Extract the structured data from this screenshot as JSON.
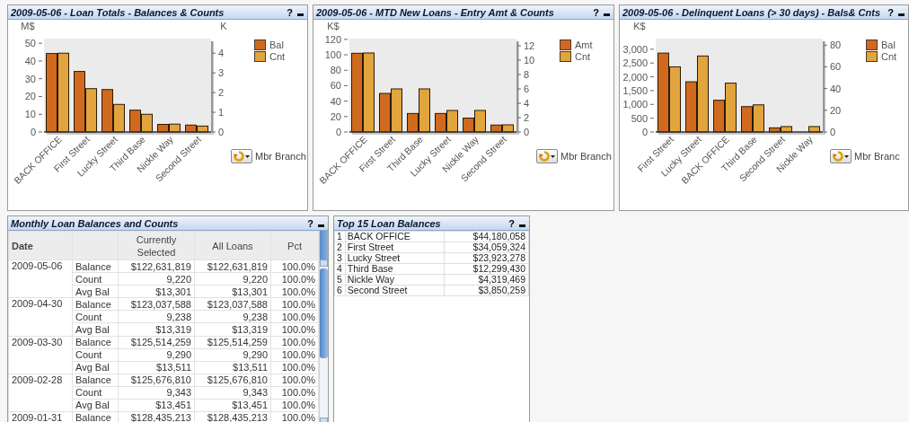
{
  "charts": [
    {
      "title": "2009-05-06 - Loan Totals - Balances & Counts",
      "help": "?",
      "cycle_label": "Mbr Branch",
      "chart_data": {
        "type": "bar",
        "ylabel": "M$",
        "y2label": "K",
        "categories": [
          "BACK OFFICE",
          "First Street",
          "Lucky Street",
          "Third Base",
          "Nickle Way",
          "Second Street"
        ],
        "ylim": [
          0,
          52.6
        ],
        "yticks": [
          0,
          10,
          20,
          30,
          40,
          50
        ],
        "y2lim": [
          0,
          4.74
        ],
        "y2ticks": [
          0,
          1,
          2,
          3,
          4
        ],
        "series": [
          {
            "name": "Bal",
            "color": "#d06a1e",
            "values": [
              44.2,
              34.1,
              23.9,
              12.3,
              4.3,
              3.9
            ]
          },
          {
            "name": "Cnt",
            "color": "#e2a43c",
            "axis": "y2",
            "values": [
              4.0,
              2.2,
              1.4,
              0.9,
              0.4,
              0.3
            ]
          }
        ],
        "stacked": false
      }
    },
    {
      "title": "2009-05-06 - MTD New Loans - Entry Amt & Counts",
      "help": "?",
      "cycle_label": "Mbr Branch",
      "chart_data": {
        "type": "bar",
        "ylabel": "K$",
        "categories": [
          "BACK OFFICE",
          "First Street",
          "Third Base",
          "Lucky Street",
          "Nickle Way",
          "Second Street"
        ],
        "ylim": [
          0,
          121
        ],
        "yticks": [
          0,
          20,
          40,
          60,
          80,
          100,
          120
        ],
        "y2lim": [
          0,
          13
        ],
        "y2ticks": [
          0,
          2,
          4,
          6,
          8,
          10,
          12
        ],
        "series": [
          {
            "name": "Amt",
            "color": "#d06a1e",
            "values": [
              102,
              50,
              24,
              24,
              18,
              9
            ]
          },
          {
            "name": "Cnt",
            "color": "#e2a43c",
            "axis": "y2",
            "values": [
              11,
              6,
              6,
              3,
              3,
              1
            ]
          }
        ],
        "stacked": false
      }
    },
    {
      "title": "2009-05-06 - Delinquent Loans (> 30 days) - Bals& Cnts",
      "help": "?",
      "cycle_label": "Mbr Branc",
      "chart_data": {
        "type": "bar",
        "ylabel": "K$",
        "categories": [
          "First Street",
          "Lucky Street",
          "BACK OFFICE",
          "Third Base",
          "Second Street",
          "Nickle Way"
        ],
        "ylim": [
          0,
          3385
        ],
        "yticks": [
          {
            "value": 0,
            "label": "0"
          },
          {
            "value": 500,
            "label": "500"
          },
          {
            "value": 1000,
            "label": "1,000"
          },
          {
            "value": 1500,
            "label": "1,500"
          },
          {
            "value": 2000,
            "label": "2,000"
          },
          {
            "value": 2500,
            "label": "2,500"
          },
          {
            "value": 3000,
            "label": "3,000"
          }
        ],
        "y2lim": [
          0,
          86
        ],
        "y2ticks": [
          0,
          20,
          40,
          60,
          80
        ],
        "series": [
          {
            "name": "Bal",
            "color": "#d06a1e",
            "values": [
              2860,
              1820,
              1150,
              920,
              150,
              null
            ]
          },
          {
            "name": "Cnt",
            "color": "#e2a43c",
            "axis": "y2",
            "values": [
              60,
              70,
              45,
              25,
              5,
              5
            ]
          }
        ],
        "stacked": false
      }
    }
  ],
  "monthly": {
    "title": "Monthly Loan Balances and Counts",
    "help": "?",
    "columns": [
      "Date",
      "Currently Selected",
      "All Loans",
      "Pct"
    ],
    "groups": [
      {
        "date": "2009-05-06",
        "rows": [
          {
            "measure": "Balance",
            "current": "$122,631,819",
            "all": "$122,631,819",
            "pct": "100.0%"
          },
          {
            "measure": "Count",
            "current": "9,220",
            "all": "9,220",
            "pct": "100.0%"
          },
          {
            "measure": "Avg Bal",
            "current": "$13,301",
            "all": "$13,301",
            "pct": "100.0%"
          }
        ]
      },
      {
        "date": "2009-04-30",
        "rows": [
          {
            "measure": "Balance",
            "current": "$123,037,588",
            "all": "$123,037,588",
            "pct": "100.0%"
          },
          {
            "measure": "Count",
            "current": "9,238",
            "all": "9,238",
            "pct": "100.0%"
          },
          {
            "measure": "Avg Bal",
            "current": "$13,319",
            "all": "$13,319",
            "pct": "100.0%"
          }
        ]
      },
      {
        "date": "2009-03-30",
        "rows": [
          {
            "measure": "Balance",
            "current": "$125,514,259",
            "all": "$125,514,259",
            "pct": "100.0%"
          },
          {
            "measure": "Count",
            "current": "9,290",
            "all": "9,290",
            "pct": "100.0%"
          },
          {
            "measure": "Avg Bal",
            "current": "$13,511",
            "all": "$13,511",
            "pct": "100.0%"
          }
        ]
      },
      {
        "date": "2009-02-28",
        "rows": [
          {
            "measure": "Balance",
            "current": "$125,676,810",
            "all": "$125,676,810",
            "pct": "100.0%"
          },
          {
            "measure": "Count",
            "current": "9,343",
            "all": "9,343",
            "pct": "100.0%"
          },
          {
            "measure": "Avg Bal",
            "current": "$13,451",
            "all": "$13,451",
            "pct": "100.0%"
          }
        ]
      },
      {
        "date": "2009-01-31",
        "rows": [
          {
            "measure": "Balance",
            "current": "$128,435,213",
            "all": "$128,435,213",
            "pct": "100.0%"
          }
        ]
      }
    ]
  },
  "top_balances": {
    "title": "Top 15 Loan Balances",
    "help": "?",
    "rows": [
      {
        "rank": "1",
        "name": "BACK OFFICE",
        "amount": "$44,180,058"
      },
      {
        "rank": "2",
        "name": "First Street",
        "amount": "$34,059,324"
      },
      {
        "rank": "3",
        "name": "Lucky Street",
        "amount": "$23,923,278"
      },
      {
        "rank": "4",
        "name": "Third Base",
        "amount": "$12,299,430"
      },
      {
        "rank": "5",
        "name": "Nickle Way",
        "amount": "$4,319,469"
      },
      {
        "rank": "6",
        "name": "Second Street",
        "amount": "$3,850,259"
      }
    ]
  }
}
